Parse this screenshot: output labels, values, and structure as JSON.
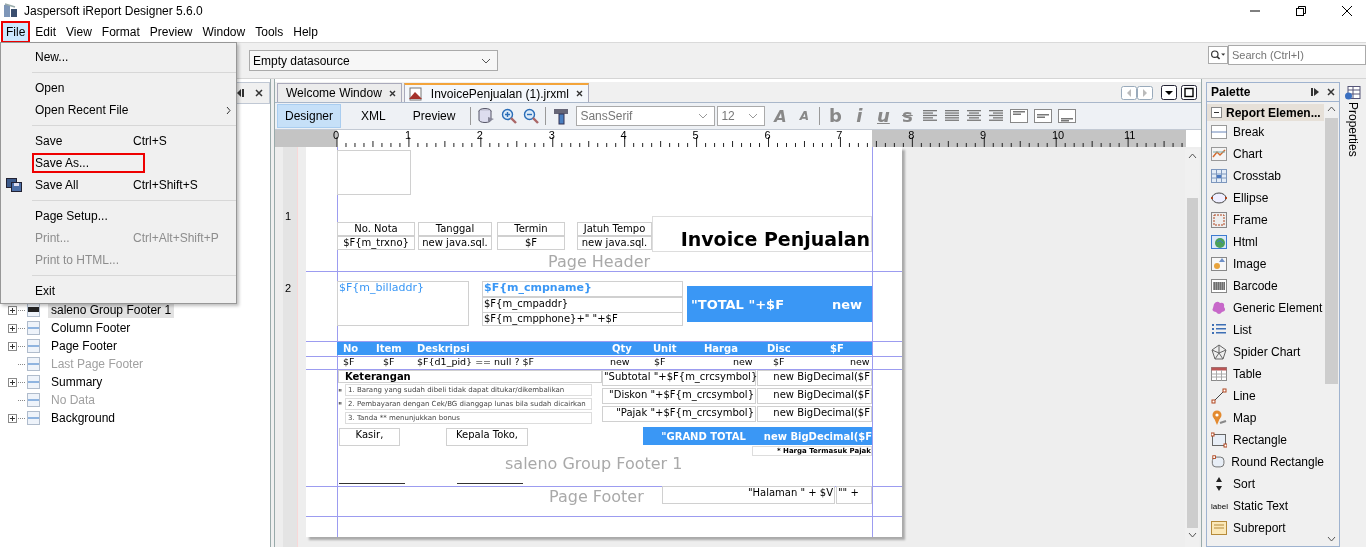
{
  "window": {
    "title": "Jaspersoft iReport Designer 5.6.0"
  },
  "menu_bar": [
    {
      "label": "File",
      "selected": true,
      "highlighted": true
    },
    {
      "label": "Edit",
      "selected": false,
      "highlighted": false
    },
    {
      "label": "View",
      "selected": false,
      "highlighted": false
    },
    {
      "label": "Format",
      "selected": false,
      "highlighted": false
    },
    {
      "label": "Preview",
      "selected": false,
      "highlighted": false
    },
    {
      "label": "Window",
      "selected": false,
      "highlighted": false
    },
    {
      "label": "Tools",
      "selected": false,
      "highlighted": false
    },
    {
      "label": "Help",
      "selected": false,
      "highlighted": false
    }
  ],
  "file_menu": {
    "items": [
      {
        "kind": "item",
        "label": "New...",
        "disabled": false,
        "highlighted": false
      },
      {
        "kind": "separator"
      },
      {
        "kind": "item",
        "label": "Open",
        "disabled": false,
        "highlighted": false
      },
      {
        "kind": "submenu",
        "label": "Open Recent File",
        "disabled": false,
        "highlighted": false
      },
      {
        "kind": "separator"
      },
      {
        "kind": "item",
        "label": "Save",
        "shortcut": "Ctrl+S",
        "disabled": false,
        "highlighted": false
      },
      {
        "kind": "item",
        "label": "Save As...",
        "disabled": false,
        "highlighted": true
      },
      {
        "kind": "item",
        "label": "Save All",
        "shortcut": "Ctrl+Shift+S",
        "disabled": false,
        "highlighted": false,
        "has_icon": true
      },
      {
        "kind": "separator"
      },
      {
        "kind": "item",
        "label": "Page Setup...",
        "disabled": false,
        "highlighted": false
      },
      {
        "kind": "item",
        "label": "Print...",
        "shortcut": "Ctrl+Alt+Shift+P",
        "disabled": true,
        "highlighted": false
      },
      {
        "kind": "item",
        "label": "Print to HTML...",
        "disabled": true,
        "highlighted": false
      },
      {
        "kind": "separator"
      },
      {
        "kind": "item",
        "label": "Exit",
        "disabled": false,
        "highlighted": false
      }
    ]
  },
  "toolbar": {
    "datasource": "Empty datasource"
  },
  "search": {
    "placeholder": "Search (Ctrl+I)"
  },
  "report_tree": [
    {
      "label": "saleno Group Footer 1",
      "expandable": true,
      "disabled": false,
      "selected": true
    },
    {
      "label": "Column Footer",
      "expandable": true,
      "disabled": false,
      "selected": false
    },
    {
      "label": "Page Footer",
      "expandable": true,
      "disabled": false,
      "selected": false
    },
    {
      "label": "Last Page Footer",
      "expandable": false,
      "disabled": true,
      "selected": false
    },
    {
      "label": "Summary",
      "expandable": true,
      "disabled": false,
      "selected": false
    },
    {
      "label": "No Data",
      "expandable": false,
      "disabled": true,
      "selected": false
    },
    {
      "label": "Background",
      "expandable": true,
      "disabled": false,
      "selected": false
    }
  ],
  "editor_tabs": [
    {
      "label": "Welcome Window",
      "selected": false
    },
    {
      "label": "InvoicePenjualan (1).jrxml",
      "selected": true
    }
  ],
  "view_tabs": [
    {
      "label": "Designer",
      "selected": true
    },
    {
      "label": "XML",
      "selected": false
    },
    {
      "label": "Preview",
      "selected": false
    }
  ],
  "format_toolbar": {
    "font": "SansSerif",
    "size": "12",
    "size_buttons": [
      "A",
      "A"
    ],
    "style_buttons": [
      "b",
      "i",
      "u",
      "s"
    ]
  },
  "ruler": {
    "numbers": [
      "0",
      "1",
      "2",
      "3",
      "4",
      "5",
      "6",
      "7",
      "8",
      "9",
      "10",
      "11"
    ],
    "side_numbers": [
      "1",
      "2"
    ]
  },
  "report": {
    "band_labels": [
      "Page Header",
      "saleno Group Footer 1",
      "Page Footer"
    ],
    "header_table": [
      {
        "heading": "No. Nota",
        "value": "$F{m_trxno}"
      },
      {
        "heading": "Tanggal",
        "value": "new java.sql."
      },
      {
        "heading": "Termin",
        "value": "$F"
      },
      {
        "heading": "Jatuh Tempo",
        "value": "new java.sql."
      }
    ],
    "title": "Invoice Penjualan",
    "bill_address": "$F{m_billaddr}",
    "company": [
      "$F{m_cmpname}",
      "$F{m_cmpaddr}",
      "$F{m_cmpphone}+\" \"+$F"
    ],
    "total_box": [
      "\"TOTAL \"+$F",
      "new"
    ],
    "columns": [
      {
        "heading": "No",
        "value": "$F"
      },
      {
        "heading": "Item",
        "value": "$F"
      },
      {
        "heading": "Deskripsi",
        "value": "$F{d1_pid} == null ? $F"
      },
      {
        "heading": "Qty",
        "value": "new"
      },
      {
        "heading": "Unit",
        "value": "$F"
      },
      {
        "heading": "Harga",
        "value": "new"
      },
      {
        "heading": "Disc",
        "value": "$F"
      },
      {
        "heading": "$F",
        "value": "new"
      }
    ],
    "notes": {
      "title": "Keterangan",
      "lines": [
        "1. Barang yang sudah dibeli tidak dapat ditukar/dikembalikan",
        "2. Pembayaran dengan Cek/BG dianggap lunas bila sudah dicairkan",
        "3. Tanda ** menunjukkan bonus"
      ],
      "marks": [
        "\"",
        "\""
      ]
    },
    "summary": [
      {
        "label": "\"Subtotal \"+$F{m_crcsymbol}",
        "value": "new BigDecimal($F"
      },
      {
        "label": "\"Diskon \"+$F{m_crcsymbol}",
        "value": "new BigDecimal($F"
      },
      {
        "label": "\"Pajak \"+$F{m_crcsymbol}",
        "value": "new BigDecimal($F"
      }
    ],
    "signatures": [
      "Kasir,",
      "Kepala Toko,"
    ],
    "grand_total": [
      "\"GRAND TOTAL",
      "new BigDecimal($F"
    ],
    "tax_note": "* Harga Termasuk Pajak",
    "page_footer": [
      "\"Halaman \" + $V",
      "\"\" +"
    ]
  },
  "palette": {
    "title": "Palette",
    "section": "Report Elemen...",
    "items": [
      {
        "label": "Break"
      },
      {
        "label": "Chart"
      },
      {
        "label": "Crosstab"
      },
      {
        "label": "Ellipse"
      },
      {
        "label": "Frame"
      },
      {
        "label": "Html"
      },
      {
        "label": "Image"
      },
      {
        "label": "Barcode"
      },
      {
        "label": "Generic Element"
      },
      {
        "label": "List"
      },
      {
        "label": "Spider Chart"
      },
      {
        "label": "Table"
      },
      {
        "label": "Line"
      },
      {
        "label": "Map"
      },
      {
        "label": "Rectangle"
      },
      {
        "label": "Round Rectangle"
      },
      {
        "label": "Sort"
      },
      {
        "label": "Static Text",
        "icon_text": "label"
      },
      {
        "label": "Subreport"
      }
    ]
  },
  "properties_tab": "Properties"
}
